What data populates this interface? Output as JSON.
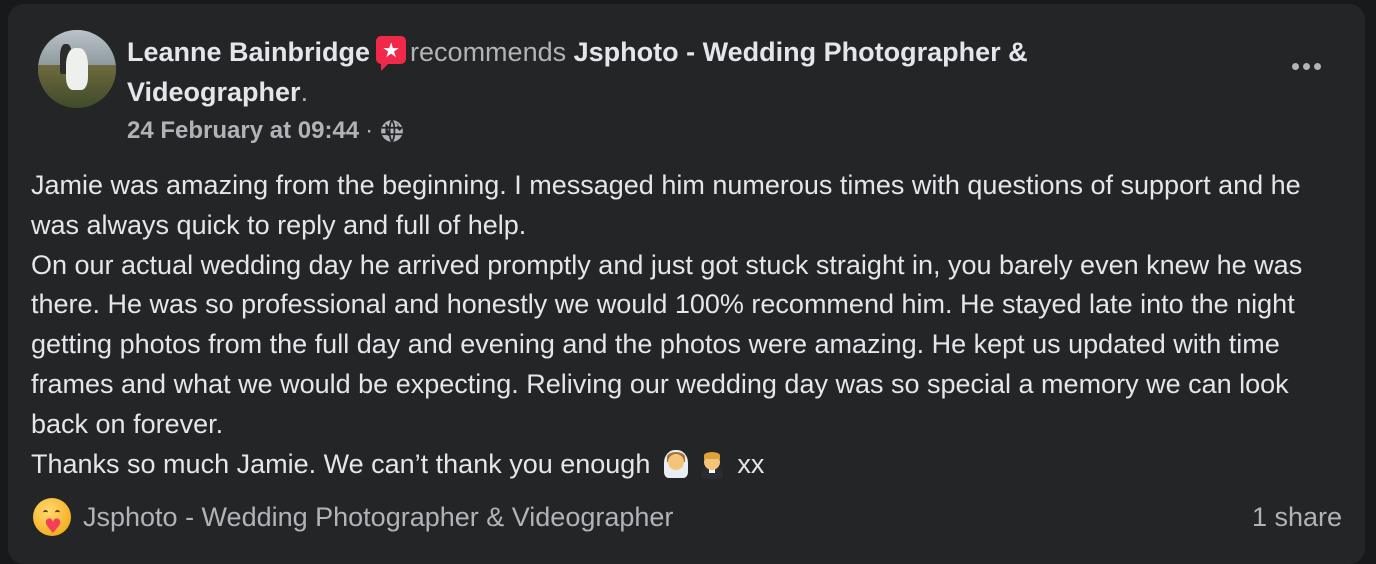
{
  "post": {
    "author": "Leanne Bainbridge",
    "action": "recommends",
    "page_name": "Jsphoto - Wedding Photographer & Videographer",
    "period": ".",
    "timestamp": "24 February at 09:44",
    "separator": "·",
    "audience_icon": "globe-icon",
    "badge_icon": "recommend-star-icon",
    "badge_color": "#f02849",
    "more_icon": "ellipsis-icon"
  },
  "body": {
    "p1": "Jamie was amazing from the beginning. I messaged him numerous times with questions of support and he was always quick to reply and full of help.",
    "p2": "On our actual wedding day he arrived promptly and just got stuck straight in, you barely even knew he was there. He was so professional and honestly we would 100% recommend him. He stayed late into the night getting photos from the full day and evening and the photos were amazing. He kept us updated with time frames and what we would be expecting. Reliving our wedding day was so special a memory we can look back on forever.",
    "p3_text": "Thanks so much Jamie. We can’t thank you enough",
    "p3_suffix": "xx",
    "emojis": [
      "bride-with-veil-emoji",
      "groom-in-tuxedo-emoji"
    ]
  },
  "footer": {
    "reaction_icon": "care-hug-icon",
    "page_label": "Jsphoto - Wedding Photographer & Videographer",
    "shares": "1 share"
  },
  "theme": {
    "background": "#242526",
    "primary_text": "#e4e6eb",
    "secondary_text": "#b0b3b8"
  }
}
